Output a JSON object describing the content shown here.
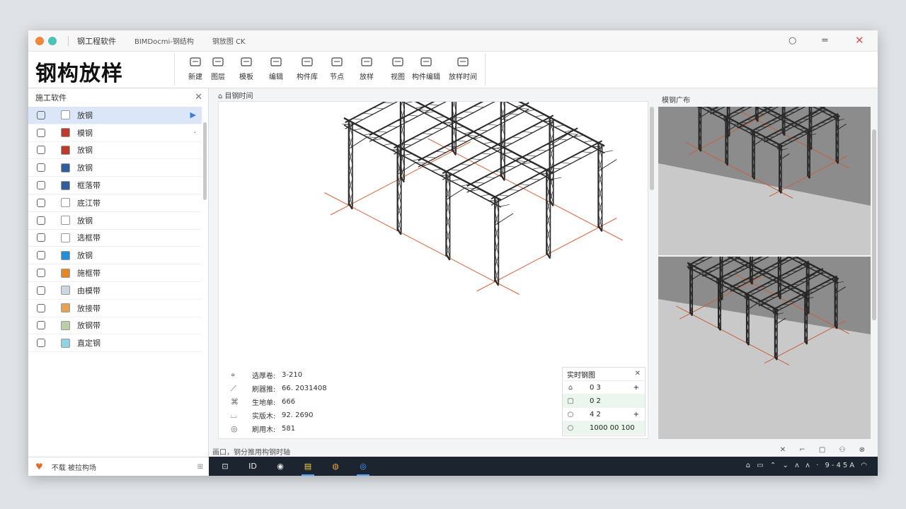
{
  "titlebar": {
    "app_title": "钢工程软件",
    "tab1": "BIMDocmi-钢结构",
    "tab2": "钢放图 CK",
    "minimize_glyph": "○",
    "maximize_glyph": "=",
    "close_glyph": "✕"
  },
  "ribbon": {
    "logo": "钢构放样",
    "tools": [
      {
        "label": "新建",
        "icon": "new-doc-icon"
      },
      {
        "label": "图层",
        "icon": "layers-icon"
      },
      {
        "label": "模板",
        "icon": "template-icon"
      },
      {
        "label": "编辑",
        "icon": "edit-icon"
      },
      {
        "label": "构件库",
        "icon": "library-icon"
      },
      {
        "label": "节点",
        "icon": "node-icon"
      },
      {
        "label": "放样",
        "icon": "lofting-icon"
      },
      {
        "label": "视图",
        "icon": "view-icon"
      },
      {
        "label": "构件编辑",
        "icon": "component-edit-icon"
      },
      {
        "label": "放样时间",
        "icon": "time-icon"
      }
    ]
  },
  "left_panel": {
    "title": "施工软件",
    "close_glyph": "✕",
    "items": [
      {
        "label": "放钢",
        "swatch": "#ffffff",
        "trail": "▶",
        "selected": true
      },
      {
        "label": "模钢",
        "swatch": "#c0392b",
        "trail": "·",
        "selected": false
      },
      {
        "label": "放钢",
        "swatch": "#c0392b",
        "trail": "",
        "selected": false
      },
      {
        "label": "放钢",
        "swatch": "#2f5d9e",
        "trail": "",
        "selected": false
      },
      {
        "label": "框落带",
        "swatch": "#2f5d9e",
        "trail": "",
        "selected": false
      },
      {
        "label": "底江带",
        "swatch": "#ffffff",
        "trail": "",
        "selected": false
      },
      {
        "label": "放钢",
        "swatch": "#ffffff",
        "trail": "",
        "selected": false
      },
      {
        "label": "选框带",
        "swatch": "#ffffff",
        "trail": "",
        "selected": false
      },
      {
        "label": "放钢",
        "swatch": "#1f8fdc",
        "trail": "",
        "selected": false
      },
      {
        "label": "施框带",
        "swatch": "#e8861f",
        "trail": "",
        "selected": false
      },
      {
        "label": "由模带",
        "swatch": "#cdd6e3",
        "trail": "",
        "selected": false
      },
      {
        "label": "放接带",
        "swatch": "#e7a24b",
        "trail": "",
        "selected": false
      },
      {
        "label": "放钢带",
        "swatch": "#b9cfa6",
        "trail": "",
        "selected": false
      },
      {
        "label": "直定钢",
        "swatch": "#8fd3e6",
        "trail": "",
        "selected": false
      }
    ]
  },
  "center": {
    "header": "目钢时间",
    "properties": [
      {
        "label": "选厚卷:",
        "value": "3-210",
        "icon": "⌖"
      },
      {
        "label": "刷器推:",
        "value": "66. 2031408",
        "icon": "⟋"
      },
      {
        "label": "生地单:",
        "value": "666",
        "icon": "⌘"
      },
      {
        "label": "实版木:",
        "value": "92. 2690",
        "icon": "⌴"
      },
      {
        "label": "刷用木:",
        "value": "581",
        "icon": "◎"
      }
    ],
    "realtime": {
      "title": "实时钢图",
      "close_glyph": "✕",
      "rows": [
        {
          "icon": "⌂",
          "value": "0 3",
          "plus": "+",
          "green": false
        },
        {
          "icon": "▢",
          "value": "0 2",
          "plus": "",
          "green": true
        },
        {
          "icon": "○",
          "value": "4 2",
          "plus": "+",
          "green": false
        },
        {
          "icon": "○",
          "value": "1000  00   100",
          "plus": "",
          "green": true
        }
      ]
    },
    "status_text": "画口，钢分推用构钢时轴",
    "status_icons": "✕ ⌐ ▢ ⚇ ⊗"
  },
  "right_panel": {
    "title": "模钢广布"
  },
  "bottom": {
    "left_text": "不载 被拉构场",
    "left_right": "⊞",
    "taskbar_items": [
      {
        "label": "⊡",
        "icon": "keyboard-icon"
      },
      {
        "label": "ID",
        "icon": "id-icon"
      },
      {
        "label": "◉",
        "icon": "media-icon"
      },
      {
        "label": "▤",
        "icon": "notes-icon"
      },
      {
        "label": "◍",
        "icon": "browser-icon"
      },
      {
        "label": "◎",
        "icon": "edge-icon"
      }
    ],
    "tray_text": "⌂ ▭ ⌃ ⌄ ᴧ ᴧ ·  9-45A  ◠"
  },
  "colors": {
    "accent": "#3b7dd8",
    "taskbar": "#1c2430",
    "axis_line": "#d9663c",
    "steel": "#2b2b2b"
  }
}
